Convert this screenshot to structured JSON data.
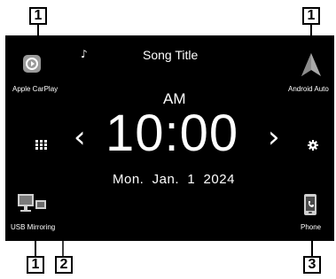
{
  "callouts": {
    "carplay": "1",
    "android_auto": "1",
    "usb_mirroring": "1",
    "menu": "2",
    "phone": "3"
  },
  "now_playing": {
    "note_icon": "music-note-icon",
    "title": "Song Title"
  },
  "apps": {
    "carplay_label": "Apple CarPlay",
    "android_label": "Android Auto",
    "usb_label": "USB Mirroring",
    "phone_label": "Phone"
  },
  "clock": {
    "ampm": "AM",
    "time": "10:00",
    "date": "Mon.  Jan.  1  2024"
  },
  "nav": {
    "prev": "‹",
    "next": "›"
  },
  "colors": {
    "screen_bg": "#000000",
    "text": "#ffffff",
    "carplay_icon": "#9a9a9a"
  }
}
